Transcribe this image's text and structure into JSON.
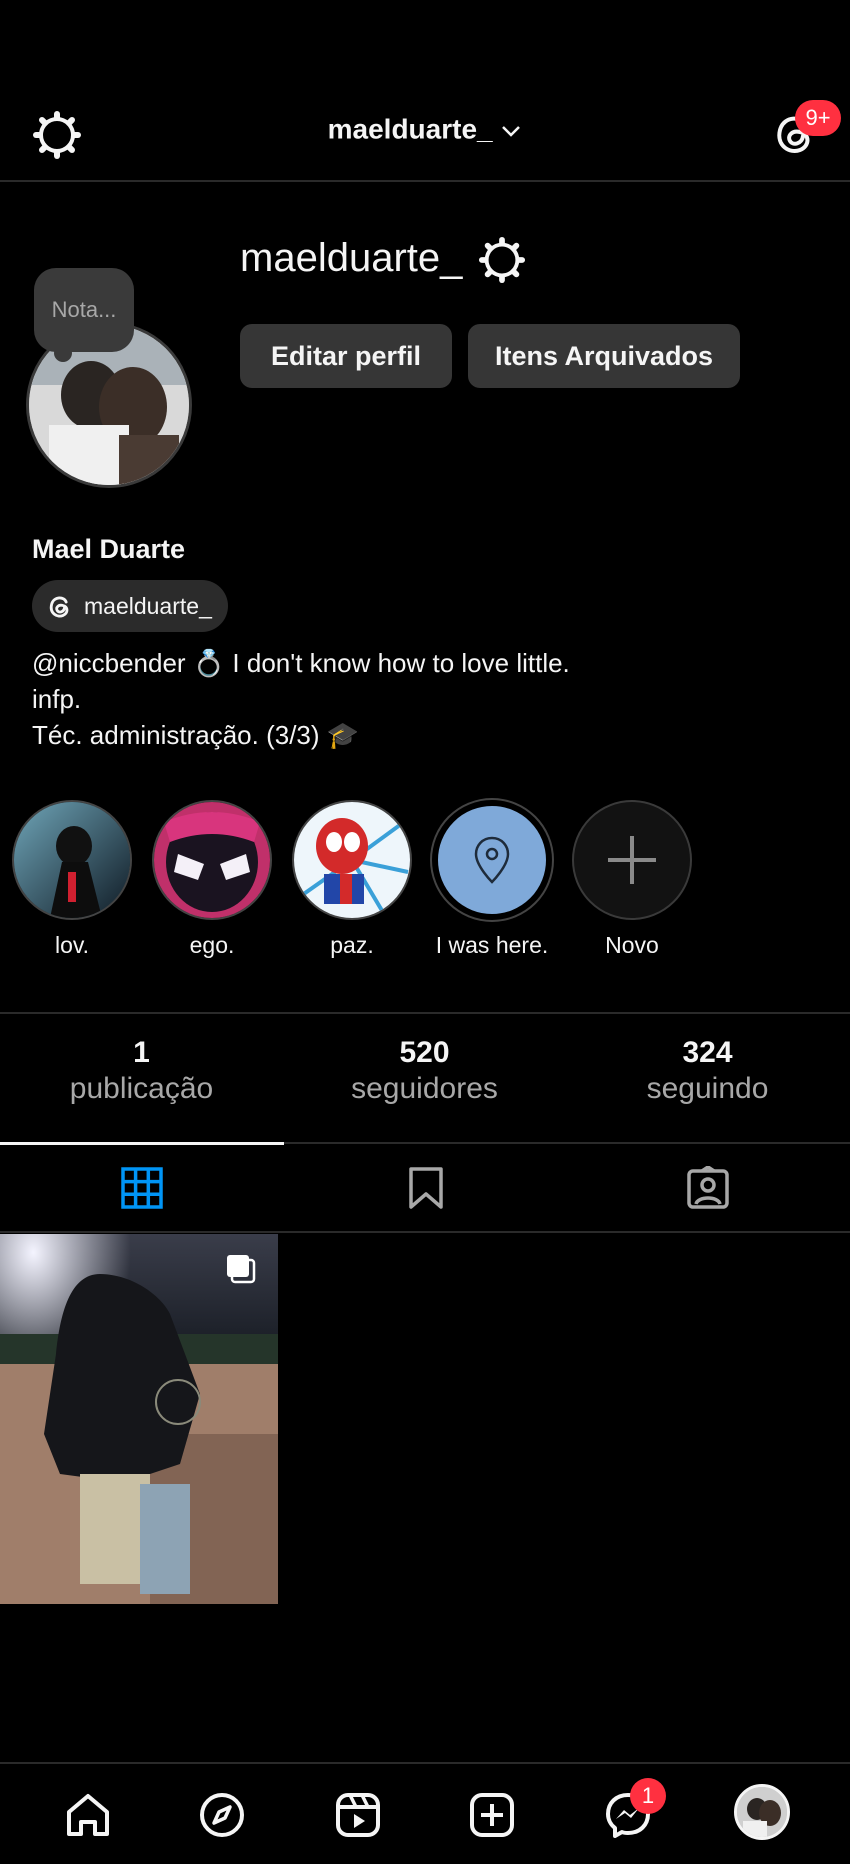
{
  "header": {
    "username": "maelduarte_",
    "notification_badge": "9+"
  },
  "profile": {
    "note_text": "Nota...",
    "username": "maelduarte_",
    "edit_button": "Editar perfil",
    "archive_button": "Itens Arquivados",
    "display_name": "Mael Duarte",
    "threads_handle": "maelduarte_",
    "bio": [
      "@niccbender 💍 I don't know how to love little.",
      "infp.",
      "Téc. administração. (3/3) 🎓"
    ]
  },
  "highlights": [
    {
      "label": "lov.",
      "icon": "spiderman-black-suit"
    },
    {
      "label": "ego.",
      "icon": "spiderman-mask"
    },
    {
      "label": "paz.",
      "icon": "spiderman-comic"
    },
    {
      "label": "I was here.",
      "icon": "location-pin-icon"
    },
    {
      "label": "Novo",
      "icon": "plus-icon"
    }
  ],
  "stats": {
    "posts": {
      "value": "1",
      "label": "publicação"
    },
    "followers": {
      "value": "520",
      "label": "seguidores"
    },
    "following": {
      "value": "324",
      "label": "seguindo"
    }
  },
  "tabs": [
    {
      "name": "grid",
      "icon": "grid-icon",
      "active": true
    },
    {
      "name": "saved",
      "icon": "bookmark-icon",
      "active": false
    },
    {
      "name": "tagged",
      "icon": "tagged-icon",
      "active": false
    }
  ],
  "posts": [
    {
      "type": "carousel",
      "icon": "multiple-images-icon"
    }
  ],
  "bottom_nav": {
    "items": [
      "home-icon",
      "explore-icon",
      "reels-icon",
      "create-icon",
      "messenger-icon",
      "profile-avatar"
    ],
    "messenger_badge": "1"
  },
  "colors": {
    "background": "#000000",
    "button": "#363636",
    "badge": "#ff3040",
    "active_tab": "#0095f6",
    "highlight_blue": "#7fa9d9"
  }
}
